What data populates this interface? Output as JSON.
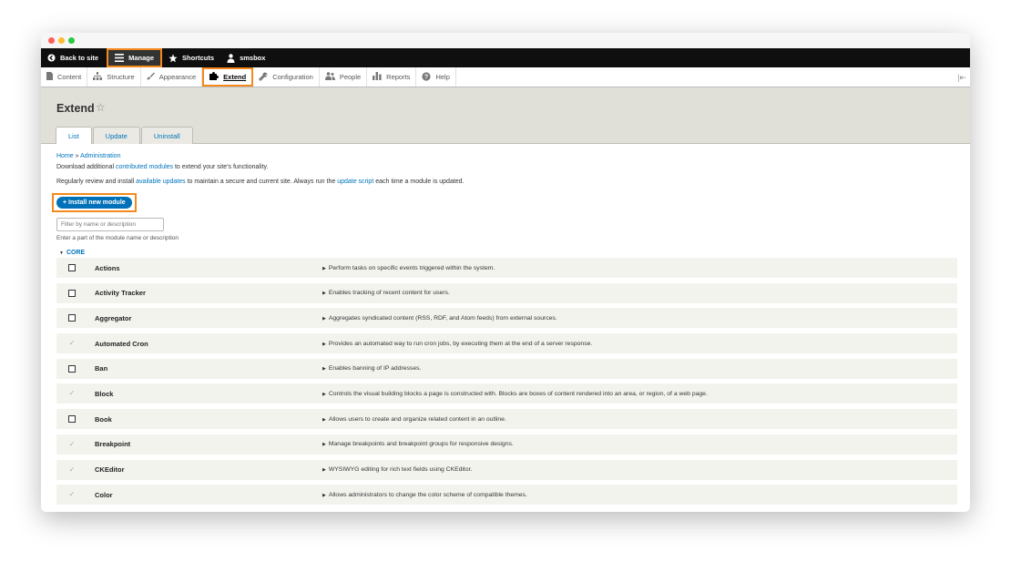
{
  "toolbar": {
    "back": "Back to site",
    "manage": "Manage",
    "shortcuts": "Shortcuts",
    "user": "smsbox"
  },
  "tray": {
    "items": [
      {
        "label": "Content",
        "icon": "file-icon"
      },
      {
        "label": "Structure",
        "icon": "sitemap-icon"
      },
      {
        "label": "Appearance",
        "icon": "paintbrush-icon"
      },
      {
        "label": "Extend",
        "icon": "puzzle-icon"
      },
      {
        "label": "Configuration",
        "icon": "wrench-icon"
      },
      {
        "label": "People",
        "icon": "people-icon"
      },
      {
        "label": "Reports",
        "icon": "bar-chart-icon"
      },
      {
        "label": "Help",
        "icon": "help-icon"
      }
    ]
  },
  "page": {
    "title": "Extend",
    "tabs": [
      "List",
      "Update",
      "Uninstall"
    ]
  },
  "breadcrumb": {
    "home": "Home",
    "sep": "»",
    "admin": "Administration"
  },
  "intro": {
    "l1_pre": "Download additional ",
    "l1_link": "contributed modules",
    "l1_post": " to extend your site's functionality.",
    "l2_pre": "Regularly review and install ",
    "l2_link": "available updates",
    "l2_mid": " to maintain a secure and current site. Always run the ",
    "l2_link2": "update script",
    "l2_post": " each time a module is updated."
  },
  "install_button": "+ Install new module",
  "filter": {
    "placeholder": "Filter by name or description",
    "description": "Enter a part of the module name or description"
  },
  "core_label": "CORE",
  "modules": [
    {
      "name": "Actions",
      "checked": false,
      "desc": "Perform tasks on specific events triggered within the system."
    },
    {
      "name": "Activity Tracker",
      "checked": false,
      "desc": "Enables tracking of recent content for users."
    },
    {
      "name": "Aggregator",
      "checked": false,
      "desc": "Aggregates syndicated content (RSS, RDF, and Atom feeds) from external sources."
    },
    {
      "name": "Automated Cron",
      "checked": true,
      "desc": "Provides an automated way to run cron jobs, by executing them at the end of a server response."
    },
    {
      "name": "Ban",
      "checked": false,
      "desc": "Enables banning of IP addresses."
    },
    {
      "name": "Block",
      "checked": true,
      "desc": "Controls the visual building blocks a page is constructed with. Blocks are boxes of content rendered into an area, or region, of a web page."
    },
    {
      "name": "Book",
      "checked": false,
      "desc": "Allows users to create and organize related content in an outline."
    },
    {
      "name": "Breakpoint",
      "checked": true,
      "desc": "Manage breakpoints and breakpoint groups for responsive designs."
    },
    {
      "name": "CKEditor",
      "checked": true,
      "desc": "WYSIWYG editing for rich text fields using CKEditor."
    },
    {
      "name": "Color",
      "checked": true,
      "desc": "Allows administrators to change the color scheme of compatible themes."
    }
  ]
}
